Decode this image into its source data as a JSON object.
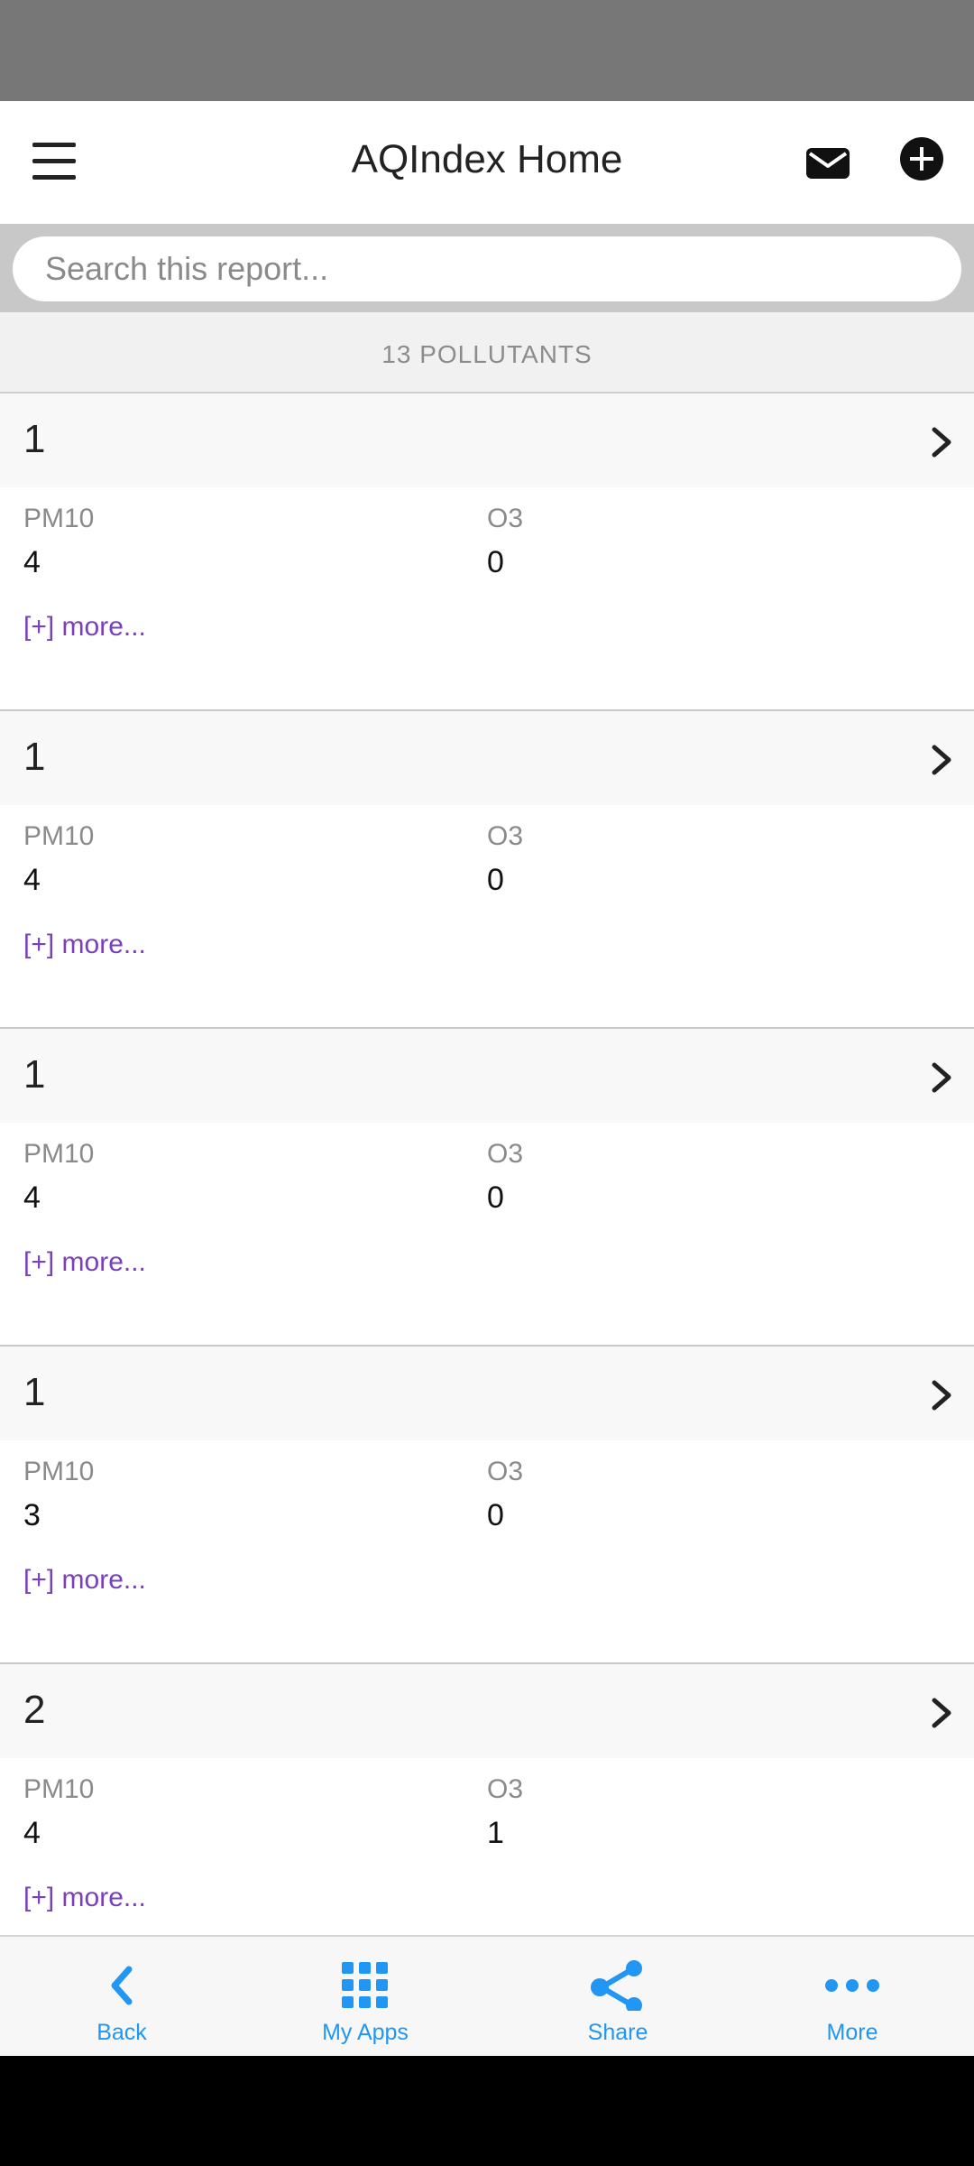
{
  "header": {
    "title": "AQIndex Home",
    "menu_icon": "hamburger-menu-icon",
    "mail_icon": "mail-icon",
    "add_icon": "plus-circle-icon"
  },
  "search": {
    "placeholder": "Search this report..."
  },
  "summary": {
    "count_label": "13 POLLUTANTS"
  },
  "records": [
    {
      "id": "1",
      "field1_label": "PM10",
      "field1_value": "4",
      "field2_label": "O3",
      "field2_value": "0",
      "more": "[+] more..."
    },
    {
      "id": "1",
      "field1_label": "PM10",
      "field1_value": "4",
      "field2_label": "O3",
      "field2_value": "0",
      "more": "[+] more..."
    },
    {
      "id": "1",
      "field1_label": "PM10",
      "field1_value": "4",
      "field2_label": "O3",
      "field2_value": "0",
      "more": "[+] more..."
    },
    {
      "id": "1",
      "field1_label": "PM10",
      "field1_value": "3",
      "field2_label": "O3",
      "field2_value": "0",
      "more": "[+] more..."
    },
    {
      "id": "2",
      "field1_label": "PM10",
      "field1_value": "4",
      "field2_label": "O3",
      "field2_value": "1",
      "more": "[+] more..."
    }
  ],
  "bottom_nav": {
    "items": [
      {
        "label": "Back",
        "icon": "chevron-left-icon"
      },
      {
        "label": "My Apps",
        "icon": "grid-icon"
      },
      {
        "label": "Share",
        "icon": "share-icon"
      },
      {
        "label": "More",
        "icon": "more-horizontal-icon"
      }
    ]
  },
  "colors": {
    "accent": "#2196f3",
    "link": "#7a3fbf",
    "status_bar": "#777777"
  }
}
